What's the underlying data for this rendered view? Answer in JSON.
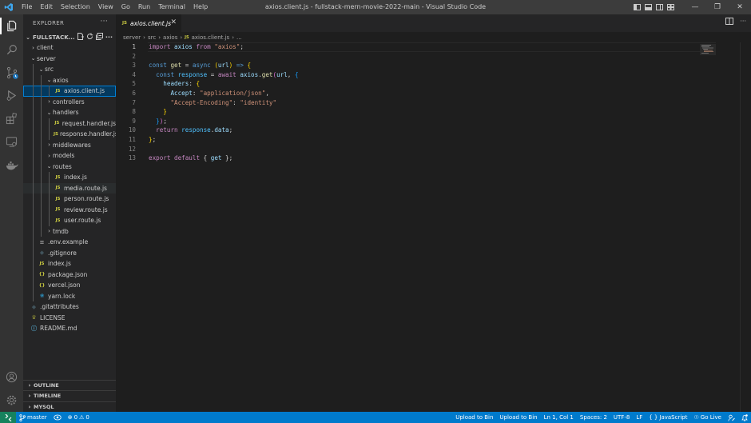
{
  "app": {
    "window_title": "axios.client.js - fullstack-mern-movie-2022-main - Visual Studio Code",
    "menu": [
      "File",
      "Edit",
      "Selection",
      "View",
      "Go",
      "Run",
      "Terminal",
      "Help"
    ]
  },
  "sidebar": {
    "title": "EXPLORER",
    "root_folder": "FULLSTACK...",
    "tree": [
      {
        "label": "client",
        "kind": "folder",
        "expanded": false,
        "depth": 0
      },
      {
        "label": "server",
        "kind": "folder",
        "expanded": true,
        "depth": 0
      },
      {
        "label": "src",
        "kind": "folder",
        "expanded": true,
        "depth": 1
      },
      {
        "label": "axios",
        "kind": "folder",
        "expanded": true,
        "depth": 2
      },
      {
        "label": "axios.client.js",
        "kind": "js",
        "depth": 3,
        "selected": true
      },
      {
        "label": "controllers",
        "kind": "folder",
        "expanded": false,
        "depth": 2
      },
      {
        "label": "handlers",
        "kind": "folder",
        "expanded": true,
        "depth": 2
      },
      {
        "label": "request.handler.js",
        "kind": "js",
        "depth": 3
      },
      {
        "label": "response.handler.js",
        "kind": "js",
        "depth": 3
      },
      {
        "label": "middlewares",
        "kind": "folder",
        "expanded": false,
        "depth": 2
      },
      {
        "label": "models",
        "kind": "folder",
        "expanded": false,
        "depth": 2
      },
      {
        "label": "routes",
        "kind": "folder",
        "expanded": true,
        "depth": 2
      },
      {
        "label": "index.js",
        "kind": "js",
        "depth": 3
      },
      {
        "label": "media.route.js",
        "kind": "js",
        "depth": 3,
        "hover": true
      },
      {
        "label": "person.route.js",
        "kind": "js",
        "depth": 3
      },
      {
        "label": "review.route.js",
        "kind": "js",
        "depth": 3
      },
      {
        "label": "user.route.js",
        "kind": "js",
        "depth": 3
      },
      {
        "label": "tmdb",
        "kind": "folder",
        "expanded": false,
        "depth": 2
      },
      {
        "label": ".env.example",
        "kind": "env",
        "depth": 1
      },
      {
        "label": ".gitignore",
        "kind": "git",
        "depth": 1
      },
      {
        "label": "index.js",
        "kind": "js",
        "depth": 1
      },
      {
        "label": "package.json",
        "kind": "json",
        "depth": 1
      },
      {
        "label": "vercel.json",
        "kind": "json",
        "depth": 1
      },
      {
        "label": "yarn.lock",
        "kind": "yarn",
        "depth": 1
      },
      {
        "label": ".gitattributes",
        "kind": "git",
        "depth": 0
      },
      {
        "label": "LICENSE",
        "kind": "license",
        "depth": 0
      },
      {
        "label": "README.md",
        "kind": "info",
        "depth": 0
      }
    ],
    "panels": [
      "OUTLINE",
      "TIMELINE",
      "MYSQL"
    ]
  },
  "editor": {
    "tab_label": "axios.client.js",
    "breadcrumb": [
      "server",
      "src",
      "axios",
      "axios.client.js",
      "..."
    ],
    "current_line": 1,
    "lines": [
      [
        {
          "t": "import",
          "c": "k"
        },
        {
          "t": " axios ",
          "c": "v2"
        },
        {
          "t": "from",
          "c": "k"
        },
        {
          "t": " ",
          "c": "t"
        },
        {
          "t": "\"axios\"",
          "c": "s"
        },
        {
          "t": ";",
          "c": "t"
        }
      ],
      [],
      [
        {
          "t": "const",
          "c": "b"
        },
        {
          "t": " ",
          "c": "t"
        },
        {
          "t": "get",
          "c": "f"
        },
        {
          "t": " = ",
          "c": "t"
        },
        {
          "t": "async",
          "c": "b"
        },
        {
          "t": " ",
          "c": "t"
        },
        {
          "t": "(",
          "c": "br1"
        },
        {
          "t": "url",
          "c": "p"
        },
        {
          "t": ")",
          "c": "br1"
        },
        {
          "t": " ",
          "c": "t"
        },
        {
          "t": "=>",
          "c": "b"
        },
        {
          "t": " ",
          "c": "t"
        },
        {
          "t": "{",
          "c": "br1"
        }
      ],
      [
        {
          "t": "  ",
          "c": "t"
        },
        {
          "t": "const",
          "c": "b"
        },
        {
          "t": " ",
          "c": "t"
        },
        {
          "t": "response",
          "c": "v"
        },
        {
          "t": " = ",
          "c": "t"
        },
        {
          "t": "await",
          "c": "k"
        },
        {
          "t": " ",
          "c": "t"
        },
        {
          "t": "axios",
          "c": "p"
        },
        {
          "t": ".",
          "c": "t"
        },
        {
          "t": "get",
          "c": "f"
        },
        {
          "t": "(",
          "c": "br2"
        },
        {
          "t": "url",
          "c": "p"
        },
        {
          "t": ", ",
          "c": "t"
        },
        {
          "t": "{",
          "c": "br3"
        }
      ],
      [
        {
          "t": "    ",
          "c": "t"
        },
        {
          "t": "headers",
          "c": "p"
        },
        {
          "t": ": ",
          "c": "t"
        },
        {
          "t": "{",
          "c": "br1"
        }
      ],
      [
        {
          "t": "      ",
          "c": "t"
        },
        {
          "t": "Accept",
          "c": "p"
        },
        {
          "t": ": ",
          "c": "t"
        },
        {
          "t": "\"application/json\"",
          "c": "s"
        },
        {
          "t": ",",
          "c": "t"
        }
      ],
      [
        {
          "t": "      ",
          "c": "t"
        },
        {
          "t": "\"Accept-Encoding\"",
          "c": "s"
        },
        {
          "t": ": ",
          "c": "t"
        },
        {
          "t": "\"identity\"",
          "c": "s"
        }
      ],
      [
        {
          "t": "    ",
          "c": "t"
        },
        {
          "t": "}",
          "c": "br1"
        }
      ],
      [
        {
          "t": "  ",
          "c": "t"
        },
        {
          "t": "}",
          "c": "br3"
        },
        {
          "t": ")",
          "c": "br2"
        },
        {
          "t": ";",
          "c": "t"
        }
      ],
      [
        {
          "t": "  ",
          "c": "t"
        },
        {
          "t": "return",
          "c": "k"
        },
        {
          "t": " ",
          "c": "t"
        },
        {
          "t": "response",
          "c": "v"
        },
        {
          "t": ".",
          "c": "t"
        },
        {
          "t": "data",
          "c": "p"
        },
        {
          "t": ";",
          "c": "t"
        }
      ],
      [
        {
          "t": "}",
          "c": "br1"
        },
        {
          "t": ";",
          "c": "t"
        }
      ],
      [],
      [
        {
          "t": "export",
          "c": "k"
        },
        {
          "t": " ",
          "c": "t"
        },
        {
          "t": "default",
          "c": "k"
        },
        {
          "t": " { ",
          "c": "t"
        },
        {
          "t": "get",
          "c": "p"
        },
        {
          "t": " };",
          "c": "t"
        }
      ]
    ]
  },
  "statusbar": {
    "branch": "master",
    "errors": "0",
    "warnings": "0",
    "upload1": "Upload to Bin",
    "upload2": "Upload to Bin",
    "position": "Ln 1, Col 1",
    "spaces": "Spaces: 2",
    "encoding": "UTF-8",
    "eol": "LF",
    "language": "JavaScript",
    "golive": "Go Live"
  },
  "colors": {
    "accent": "#007acc",
    "remote": "#16825d",
    "js_icon": "#cbcb41"
  }
}
